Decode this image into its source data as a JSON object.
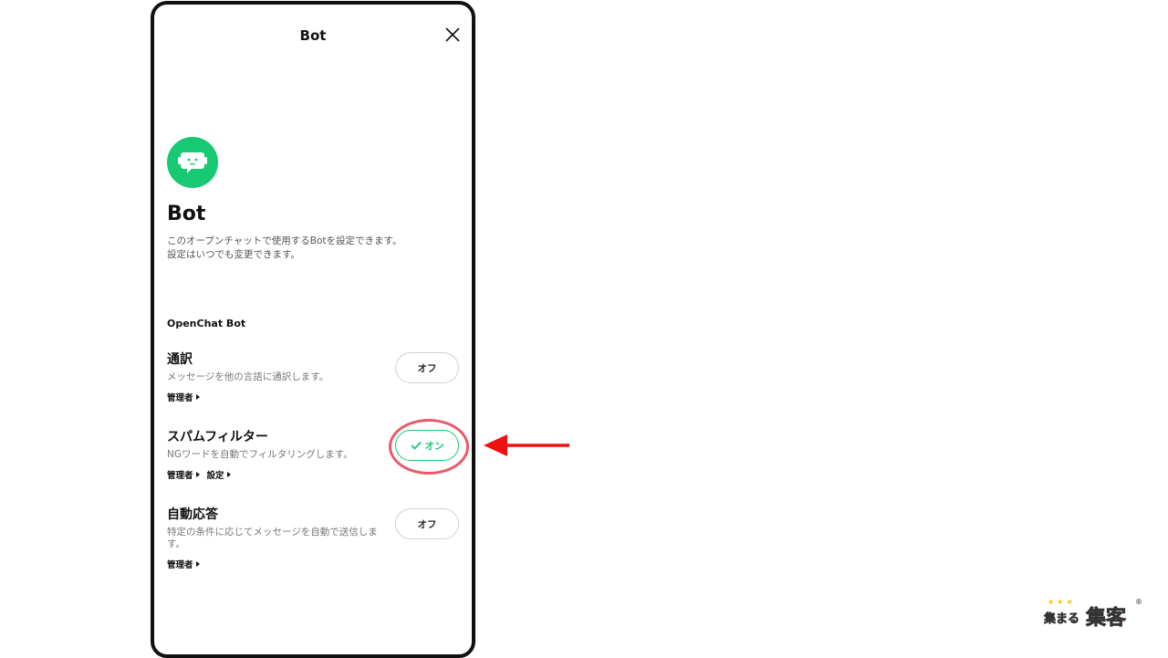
{
  "header": {
    "title": "Bot"
  },
  "intro": {
    "title": "Bot",
    "description": "このオープンチャットで使用するBotを設定できます。設定はいつでも変更できます。"
  },
  "section": {
    "label": "OpenChat Bot"
  },
  "items": [
    {
      "title": "通訳",
      "description": "メッセージを他の言語に通訳します。",
      "links": [
        "管理者"
      ],
      "toggle": {
        "label": "オフ",
        "state": "off"
      }
    },
    {
      "title": "スパムフィルター",
      "description": "NGワードを自動でフィルタリングします。",
      "links": [
        "管理者",
        "設定"
      ],
      "toggle": {
        "label": "オン",
        "state": "on"
      }
    },
    {
      "title": "自動応答",
      "description": "特定の条件に応じてメッセージを自動で送信します。",
      "links": [
        "管理者"
      ],
      "toggle": {
        "label": "オフ",
        "state": "off"
      }
    }
  ],
  "logo": {
    "text_a": "集まる",
    "text_b": "集客",
    "stars": "★★★",
    "reg": "®"
  },
  "colors": {
    "accent": "#16c972",
    "highlight": "#e85a6a",
    "arrow": "#ee1111"
  }
}
